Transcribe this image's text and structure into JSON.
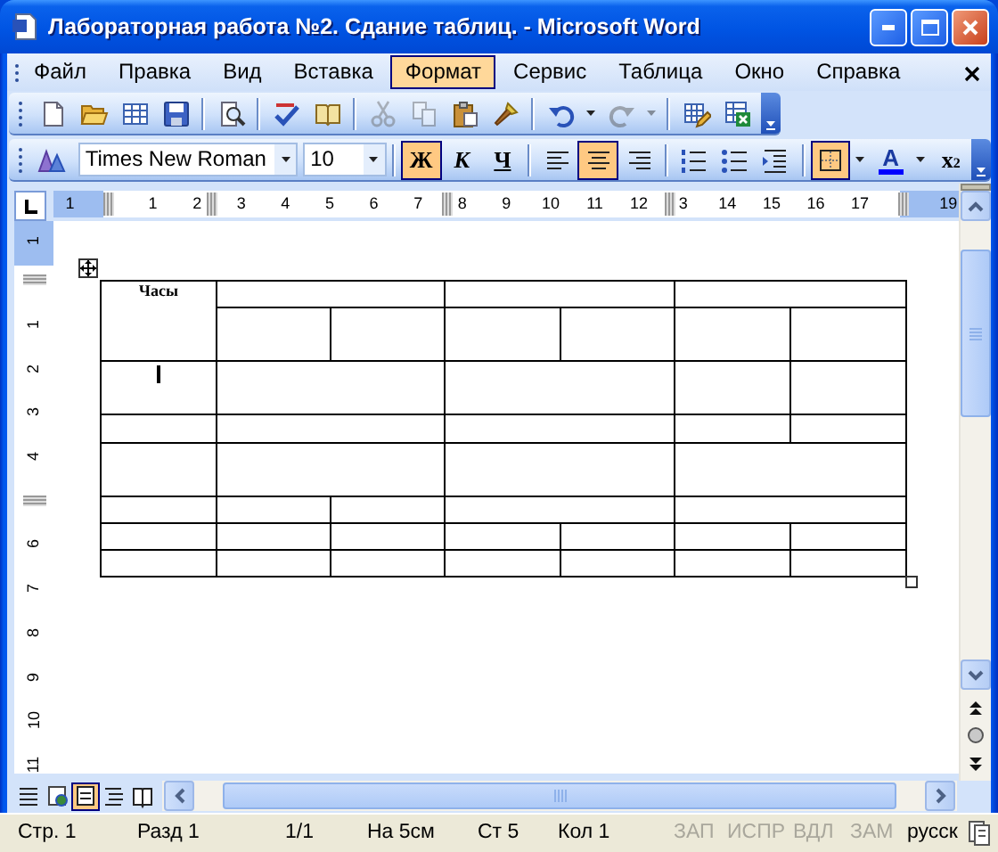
{
  "window": {
    "title": "Лабораторная работа №2. Сдание таблиц. - Microsoft Word"
  },
  "menu": [
    {
      "label": "Файл",
      "selected": false
    },
    {
      "label": "Правка",
      "selected": false
    },
    {
      "label": "Вид",
      "selected": false
    },
    {
      "label": "Вставка",
      "selected": false
    },
    {
      "label": "Формат",
      "selected": true
    },
    {
      "label": "Сервис",
      "selected": false
    },
    {
      "label": "Таблица",
      "selected": false
    },
    {
      "label": "Окно",
      "selected": false
    },
    {
      "label": "Справка",
      "selected": false
    }
  ],
  "standard_toolbar": [
    {
      "kind": "new",
      "disabled": false
    },
    {
      "kind": "open",
      "disabled": false
    },
    {
      "kind": "table",
      "disabled": false
    },
    {
      "kind": "save",
      "disabled": false
    },
    {
      "kind": "separator"
    },
    {
      "kind": "print-preview",
      "disabled": false
    },
    {
      "kind": "separator"
    },
    {
      "kind": "spelling",
      "disabled": false
    },
    {
      "kind": "research",
      "disabled": false
    },
    {
      "kind": "separator"
    },
    {
      "kind": "cut",
      "disabled": true
    },
    {
      "kind": "copy",
      "disabled": true
    },
    {
      "kind": "paste",
      "disabled": false
    },
    {
      "kind": "format-painter",
      "disabled": false
    },
    {
      "kind": "separator"
    },
    {
      "kind": "undo",
      "disabled": false
    },
    {
      "kind": "dropdown",
      "disabled": false
    },
    {
      "kind": "redo",
      "disabled": true
    },
    {
      "kind": "dropdown",
      "disabled": true
    },
    {
      "kind": "separator"
    },
    {
      "kind": "tables-borders",
      "disabled": false
    },
    {
      "kind": "excel",
      "disabled": false
    }
  ],
  "formatting_toolbar": [
    {
      "kind": "styles",
      "on": false
    },
    {
      "kind": "font-name",
      "value": "Times New Roman"
    },
    {
      "kind": "font-size",
      "value": "10"
    },
    {
      "kind": "separator"
    },
    {
      "kind": "bold",
      "label": "Ж",
      "on": true
    },
    {
      "kind": "italic",
      "label": "К",
      "on": false
    },
    {
      "kind": "underline",
      "label": "Ч",
      "on": false
    },
    {
      "kind": "separator"
    },
    {
      "kind": "align-left",
      "on": false
    },
    {
      "kind": "align-center",
      "on": true
    },
    {
      "kind": "align-right",
      "on": false
    },
    {
      "kind": "separator"
    },
    {
      "kind": "numbering",
      "on": false
    },
    {
      "kind": "bullets",
      "on": false
    },
    {
      "kind": "indent",
      "on": false
    },
    {
      "kind": "separator"
    },
    {
      "kind": "borders",
      "on": true
    },
    {
      "kind": "dropdown",
      "on": false
    },
    {
      "kind": "font-color",
      "label": "A",
      "on": false
    },
    {
      "kind": "dropdown",
      "on": false
    },
    {
      "kind": "subscript",
      "label": "x$_{2}$",
      "on": false
    }
  ],
  "ruler": {
    "horizontal": [
      {
        "kind": "number",
        "text": "1"
      },
      {
        "kind": "marker"
      },
      {
        "kind": "number",
        "text": "1"
      },
      {
        "kind": "number",
        "text": "2"
      },
      {
        "kind": "number",
        "text": "3"
      },
      {
        "kind": "number",
        "text": "4"
      },
      {
        "kind": "number",
        "text": "5"
      },
      {
        "kind": "number",
        "text": "6"
      },
      {
        "kind": "number",
        "text": "7"
      },
      {
        "kind": "number",
        "text": "8"
      },
      {
        "kind": "number",
        "text": "9"
      },
      {
        "kind": "number",
        "text": "10"
      },
      {
        "kind": "number",
        "text": "11"
      },
      {
        "kind": "number",
        "text": "12"
      },
      {
        "kind": "number",
        "text": "3"
      },
      {
        "kind": "number",
        "text": "14"
      },
      {
        "kind": "number",
        "text": "15"
      },
      {
        "kind": "number",
        "text": "16"
      },
      {
        "kind": "number",
        "text": "17"
      },
      {
        "kind": "marker"
      },
      {
        "kind": "number",
        "text": "19"
      }
    ],
    "vertical": [
      {
        "kind": "number",
        "text": "1"
      },
      {
        "kind": "marker"
      },
      {
        "kind": "number",
        "text": "1"
      },
      {
        "kind": "number",
        "text": "2"
      },
      {
        "kind": "number",
        "text": "3"
      },
      {
        "kind": "number",
        "text": "4"
      },
      {
        "kind": "marker"
      },
      {
        "kind": "number",
        "text": "6"
      },
      {
        "kind": "number",
        "text": "7"
      },
      {
        "kind": "number",
        "text": "8"
      },
      {
        "kind": "number",
        "text": "9"
      },
      {
        "kind": "number",
        "text": "10"
      },
      {
        "kind": "number",
        "text": "11"
      }
    ]
  },
  "document": {
    "table": {
      "rows": [
        [
          {
            "text": "Часы",
            "rowspan": 2,
            "cursor": false
          },
          {
            "colspan": 2,
            "cursor": false
          },
          {
            "colspan": 2,
            "cursor": false
          },
          {
            "colspan": 2,
            "cursor": false
          }
        ],
        [
          {
            "cursor": false
          },
          {
            "cursor": false
          },
          {
            "cursor": false
          },
          {
            "cursor": false
          },
          {
            "cursor": false
          },
          {
            "cursor": false
          }
        ],
        [
          {
            "cursor": true
          },
          {
            "colspan": 2,
            "cursor": false
          },
          {
            "colspan": 2,
            "cursor": false
          },
          {
            "cursor": false
          },
          {
            "cursor": false
          }
        ],
        [
          {
            "cursor": false
          },
          {
            "colspan": 2,
            "cursor": false
          },
          {
            "colspan": 2,
            "cursor": false
          },
          {
            "cursor": false
          },
          {
            "cursor": false
          }
        ],
        [
          {
            "cursor": false
          },
          {
            "colspan": 2,
            "cursor": false
          },
          {
            "colspan": 2,
            "cursor": false
          },
          {
            "colspan": 2,
            "cursor": false
          }
        ],
        [
          {
            "cursor": false
          },
          {
            "cursor": false
          },
          {
            "cursor": false
          },
          {
            "colspan": 2,
            "cursor": false
          },
          {
            "colspan": 2,
            "cursor": false
          }
        ],
        [
          {
            "cursor": false
          },
          {
            "cursor": false
          },
          {
            "cursor": false
          },
          {
            "cursor": false
          },
          {
            "cursor": false
          },
          {
            "cursor": false
          },
          {
            "cursor": false
          }
        ],
        [
          {
            "cursor": false
          },
          {
            "cursor": false
          },
          {
            "cursor": false
          },
          {
            "cursor": false
          },
          {
            "cursor": false
          },
          {
            "cursor": false
          },
          {
            "cursor": false
          }
        ]
      ]
    }
  },
  "view_buttons": [
    {
      "kind": "normal",
      "selected": false
    },
    {
      "kind": "web",
      "selected": false
    },
    {
      "kind": "print",
      "selected": true
    },
    {
      "kind": "outline",
      "selected": false
    },
    {
      "kind": "reading",
      "selected": false
    }
  ],
  "status_bar": [
    {
      "text": "Стр. 1",
      "disabled": false
    },
    {
      "text": "Разд 1",
      "disabled": false
    },
    {
      "text": "1/1",
      "disabled": false
    },
    {
      "text": "На 5см",
      "disabled": false
    },
    {
      "text": "Ст 5",
      "disabled": false
    },
    {
      "text": "Кол 1",
      "disabled": false
    },
    {
      "text": "ЗАП",
      "disabled": true
    },
    {
      "text": "ИСПР",
      "disabled": true
    },
    {
      "text": "ВДЛ",
      "disabled": true
    },
    {
      "text": "ЗАМ",
      "disabled": true
    },
    {
      "text": "русск",
      "disabled": false
    }
  ]
}
